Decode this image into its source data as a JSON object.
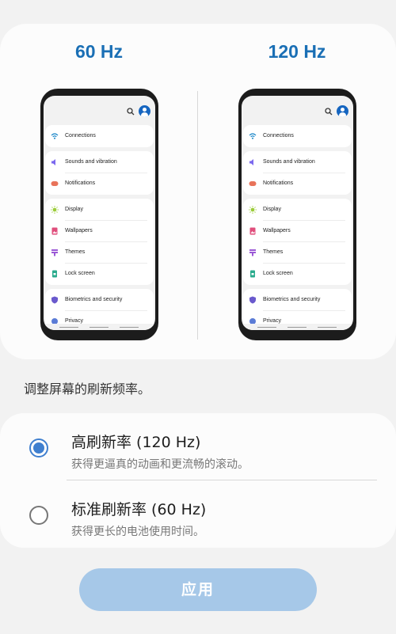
{
  "preview": {
    "left_label": "60 Hz",
    "right_label": "120 Hz"
  },
  "phone_settings": [
    {
      "label": "Connections",
      "icon": "wifi-icon"
    },
    {
      "label": "Sounds and vibration",
      "icon": "speaker-icon"
    },
    {
      "label": "Notifications",
      "icon": "notification-icon"
    },
    {
      "label": "Display",
      "icon": "sun-icon"
    },
    {
      "label": "Wallpapers",
      "icon": "image-icon"
    },
    {
      "label": "Themes",
      "icon": "brush-icon"
    },
    {
      "label": "Lock screen",
      "icon": "lock-icon"
    },
    {
      "label": "Biometrics and security",
      "icon": "shield-icon"
    },
    {
      "label": "Privacy",
      "icon": "privacy-icon"
    }
  ],
  "instruction": "调整屏幕的刷新频率。",
  "options": [
    {
      "title": "高刷新率 (120 Hz)",
      "subtitle": "获得更逼真的动画和更流畅的滚动。",
      "selected": true
    },
    {
      "title": "标准刷新率 (60 Hz)",
      "subtitle": "获得更长的电池使用时间。",
      "selected": false
    }
  ],
  "apply_label": "应用",
  "colors": {
    "accent": "#1a6fb5",
    "radio_selected": "#3f7fcf",
    "apply_button": "#a6c8e8"
  }
}
